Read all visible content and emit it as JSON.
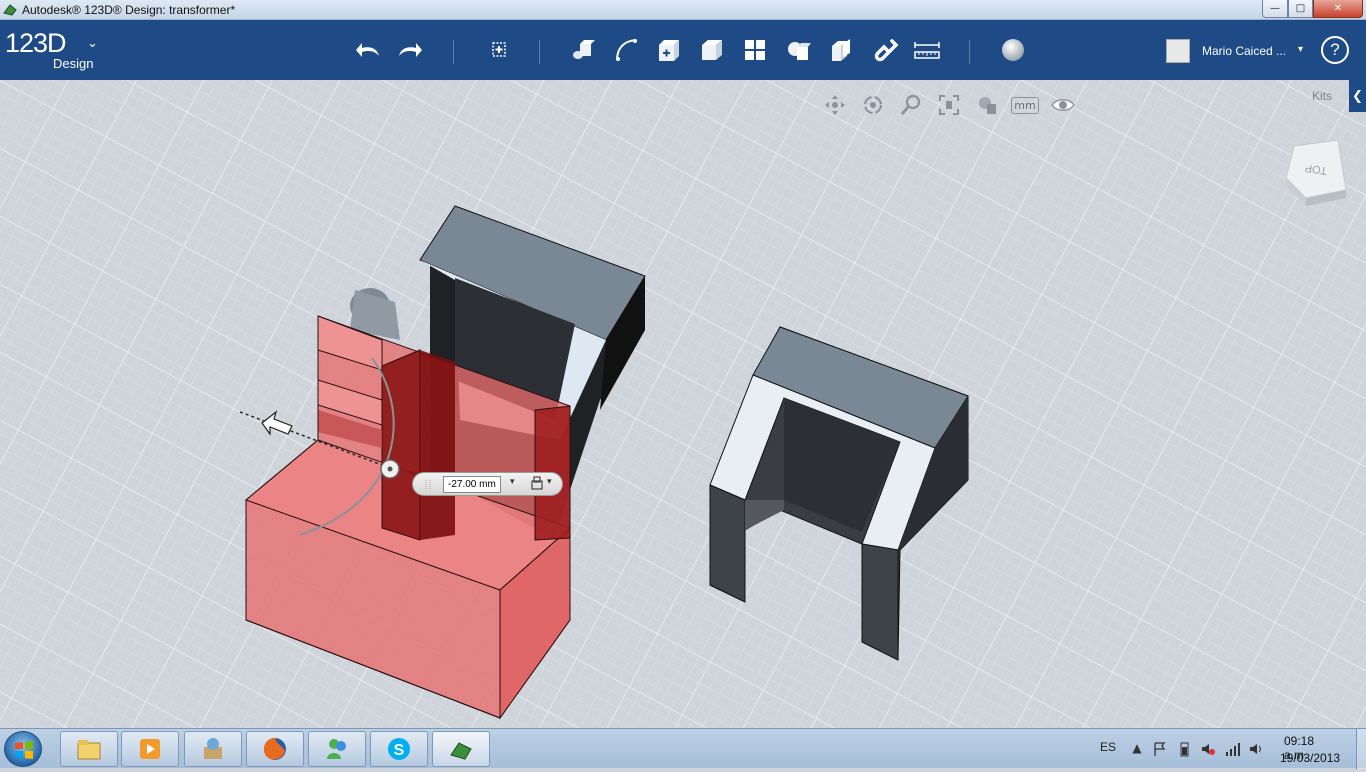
{
  "window": {
    "title": "Autodesk® 123D® Design: transformer*",
    "minimize": "—",
    "maximize": "□",
    "close": "✕"
  },
  "app": {
    "logo_main": "123D",
    "logo_sub": "Design",
    "logo_caret": "⌄"
  },
  "toolbar": {
    "tools": [
      {
        "name": "undo-icon"
      },
      {
        "name": "redo-icon"
      },
      {
        "name": "transform-icon"
      },
      {
        "name": "primitives-icon"
      },
      {
        "name": "sketch-icon"
      },
      {
        "name": "construct-icon"
      },
      {
        "name": "modify-icon"
      },
      {
        "name": "pattern-icon"
      },
      {
        "name": "group-icon"
      },
      {
        "name": "combine-icon"
      },
      {
        "name": "snap-icon"
      },
      {
        "name": "measure-icon"
      },
      {
        "name": "material-icon"
      }
    ]
  },
  "user": {
    "name": "Mario Caiced ...",
    "caret": "▾",
    "help": "?"
  },
  "viewport": {
    "units": "mm",
    "kits_label": "Kits",
    "kits_arrow": "❮",
    "viewcube_face": "TOP",
    "dimension_value": "-27.00 mm",
    "dim_caret": "▾"
  },
  "taskbar": {
    "apps": [
      {
        "name": "explorer-icon"
      },
      {
        "name": "media-player-icon"
      },
      {
        "name": "archive-icon"
      },
      {
        "name": "firefox-icon"
      },
      {
        "name": "messenger-icon"
      },
      {
        "name": "skype-icon"
      },
      {
        "name": "123d-design-icon"
      }
    ],
    "language": "ES",
    "time": "09:18 a.m.",
    "date": "19/03/2013"
  },
  "colors": {
    "toolbar_bg": "#1e4a86",
    "viewport_bg": "#ced4da",
    "selection_red": "#e86a6a",
    "part_grey": "#7a8896"
  }
}
